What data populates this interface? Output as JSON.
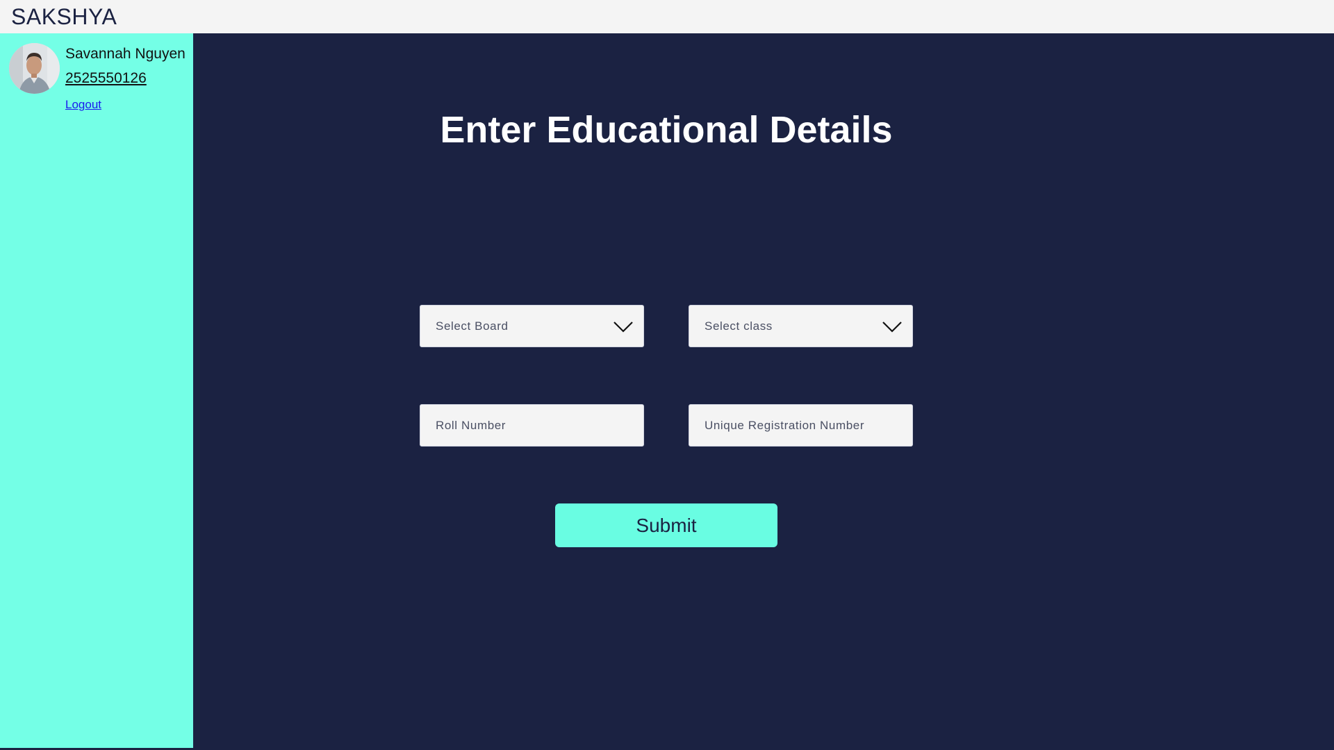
{
  "app": {
    "brand": "SAKSHYA"
  },
  "user": {
    "name": "Savannah Nguyen",
    "phone": "2525550126",
    "logout_label": "Logout"
  },
  "main": {
    "title": "Enter Educational Details",
    "board_select": {
      "placeholder": "Select Board",
      "icon": "chevron-down-icon"
    },
    "class_select": {
      "placeholder": "Select class",
      "icon": "chevron-down-icon"
    },
    "roll_input": {
      "placeholder": "Roll Number",
      "value": ""
    },
    "registration_input": {
      "placeholder": "Unique Registration Number",
      "value": ""
    },
    "submit_label": "Submit"
  },
  "colors": {
    "topbar_bg": "#f4f4f4",
    "sidebar_bg": "#74ffe6",
    "main_bg": "#1b2242",
    "accent": "#69fde2",
    "link": "#1a1aee"
  }
}
